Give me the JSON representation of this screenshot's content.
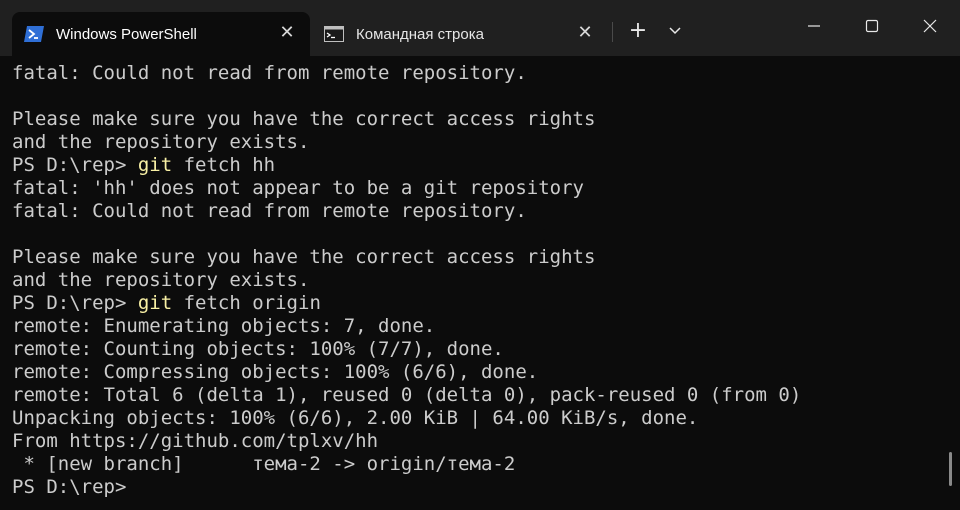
{
  "window": {
    "tabs": [
      {
        "title": "Windows PowerShell",
        "active": true,
        "icon": "powershell-icon"
      },
      {
        "title": "Командная строка",
        "active": false,
        "icon": "cmd-icon"
      }
    ],
    "new_tab_glyph": "+",
    "close_glyph": "✕",
    "accent_command": "#f9f1a5",
    "text_color": "#cccccc",
    "background": "#0c0c0c"
  },
  "terminal": {
    "lines": [
      {
        "text": "fatal: Could not read from remote repository."
      },
      {
        "text": ""
      },
      {
        "text": "Please make sure you have the correct access rights"
      },
      {
        "text": "and the repository exists."
      },
      {
        "prompt": "PS D:\\rep> ",
        "cmd": "git",
        "rest": " fetch hh"
      },
      {
        "text": "fatal: 'hh' does not appear to be a git repository"
      },
      {
        "text": "fatal: Could not read from remote repository."
      },
      {
        "text": ""
      },
      {
        "text": "Please make sure you have the correct access rights"
      },
      {
        "text": "and the repository exists."
      },
      {
        "prompt": "PS D:\\rep> ",
        "cmd": "git",
        "rest": " fetch origin"
      },
      {
        "text": "remote: Enumerating objects: 7, done."
      },
      {
        "text": "remote: Counting objects: 100% (7/7), done."
      },
      {
        "text": "remote: Compressing objects: 100% (6/6), done."
      },
      {
        "text": "remote: Total 6 (delta 1), reused 0 (delta 0), pack-reused 0 (from 0)"
      },
      {
        "text": "Unpacking objects: 100% (6/6), 2.00 KiB | 64.00 KiB/s, done."
      },
      {
        "text": "From https://github.com/tplxv/hh"
      },
      {
        "text": " * [new branch]      тема-2 -> origin/тема-2"
      },
      {
        "prompt": "PS D:\\rep>",
        "cmd": "",
        "rest": ""
      }
    ]
  }
}
